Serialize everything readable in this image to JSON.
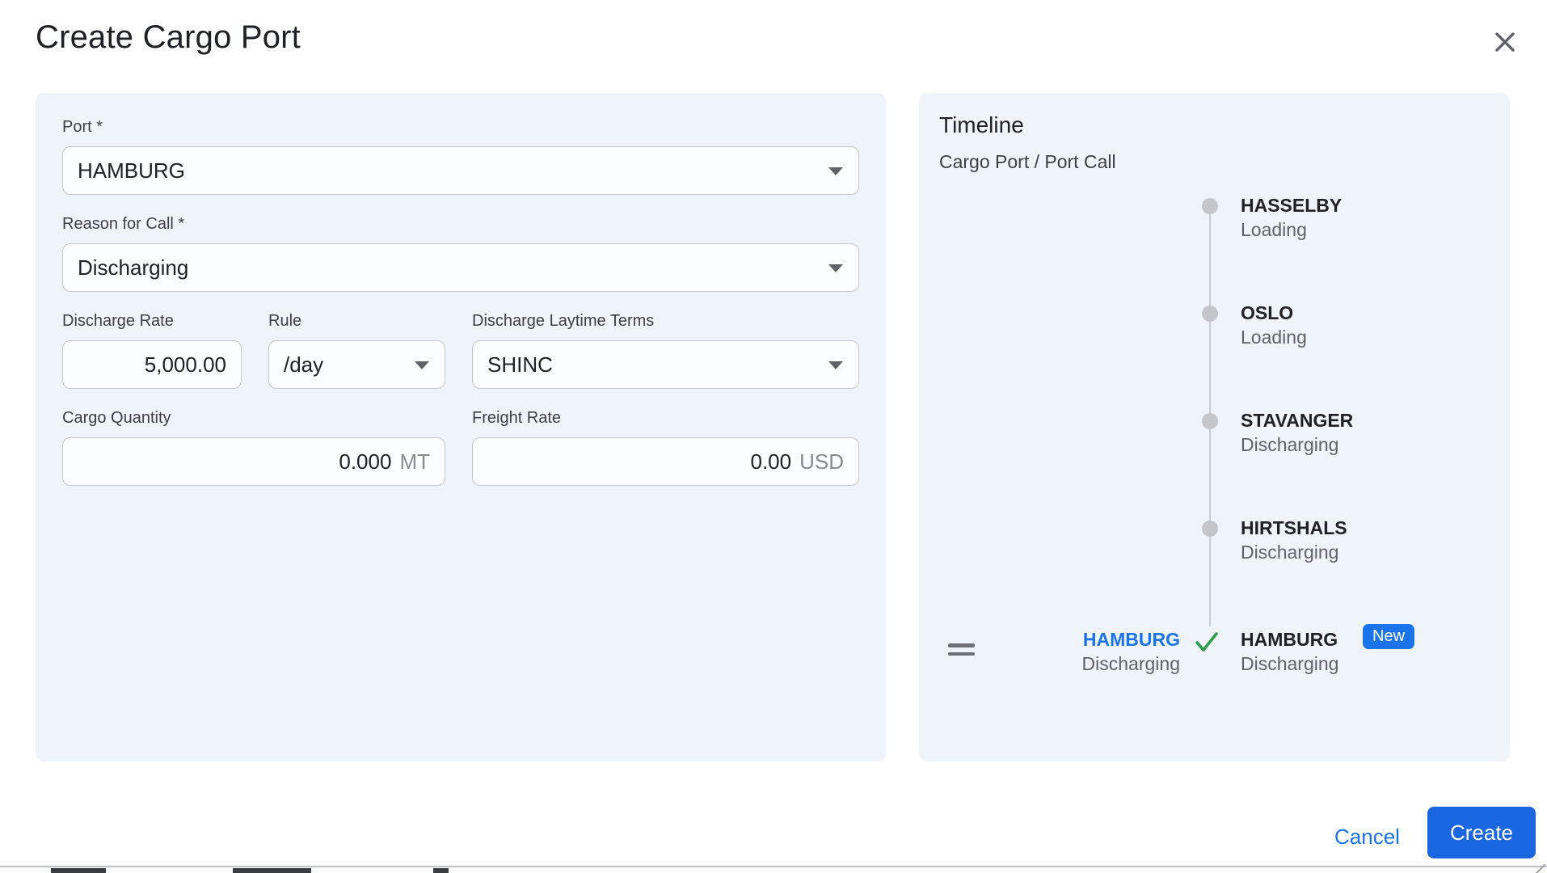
{
  "dialog": {
    "title": "Create Cargo Port"
  },
  "form": {
    "port": {
      "label": "Port *",
      "value": "HAMBURG"
    },
    "reason_for_call": {
      "label": "Reason for Call *",
      "value": "Discharging"
    },
    "discharge_rate": {
      "label": "Discharge Rate",
      "value": "5,000.00"
    },
    "rule": {
      "label": "Rule",
      "value": "/day"
    },
    "discharge_laytime_terms": {
      "label": "Discharge Laytime Terms",
      "value": "SHINC"
    },
    "cargo_quantity": {
      "label": "Cargo Quantity",
      "value": "0.000",
      "unit": "MT"
    },
    "freight_rate": {
      "label": "Freight Rate",
      "value": "0.00",
      "unit": "USD"
    }
  },
  "timeline": {
    "title": "Timeline",
    "subtitle": "Cargo Port / Port Call",
    "entries": [
      {
        "port": "HASSELBY",
        "activity": "Loading"
      },
      {
        "port": "OSLO",
        "activity": "Loading"
      },
      {
        "port": "STAVANGER",
        "activity": "Discharging"
      },
      {
        "port": "HIRTSHALS",
        "activity": "Discharging"
      },
      {
        "port": "HAMBURG",
        "activity": "Discharging",
        "badge": "New"
      }
    ],
    "pending_item": {
      "port": "HAMBURG",
      "activity": "Discharging"
    }
  },
  "footer": {
    "cancel_label": "Cancel",
    "create_label": "Create"
  },
  "colors": {
    "panel_bg": "#EFF4FB",
    "accent_blue": "#1A66E0",
    "link_blue": "#1A73E8",
    "badge_blue": "#1A73E8",
    "check_green": "#2E9E4D",
    "dot_gray": "#C2C5C9",
    "status_gray": "#5F6368"
  }
}
